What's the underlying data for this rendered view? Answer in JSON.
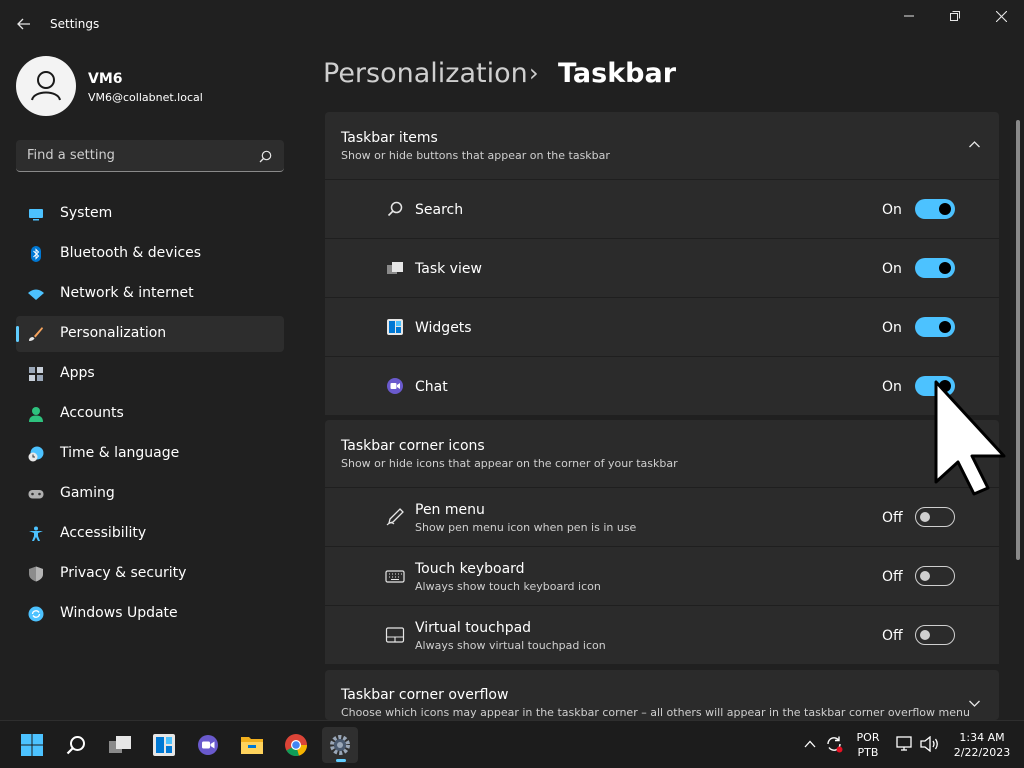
{
  "window": {
    "title": "Settings",
    "controls": {
      "minimize": "minimize-icon",
      "restore": "restore-icon",
      "close": "close-icon"
    }
  },
  "profile": {
    "name": "VM6",
    "email": "VM6@collabnet.local"
  },
  "search": {
    "placeholder": "Find a setting"
  },
  "nav": {
    "items": [
      {
        "label": "System",
        "icon": "system-icon",
        "color": "#4cc2ff"
      },
      {
        "label": "Bluetooth & devices",
        "icon": "bluetooth-icon",
        "color": "#0078d4"
      },
      {
        "label": "Network & internet",
        "icon": "wifi-icon",
        "color": "#4cc2ff"
      },
      {
        "label": "Personalization",
        "icon": "brush-icon",
        "color": "#f7a35c",
        "selected": true
      },
      {
        "label": "Apps",
        "icon": "apps-icon",
        "color": "#9aa7b8"
      },
      {
        "label": "Accounts",
        "icon": "accounts-icon",
        "color": "#2ec27e"
      },
      {
        "label": "Time & language",
        "icon": "clock-globe-icon",
        "color": "#4cc2ff"
      },
      {
        "label": "Gaming",
        "icon": "gamepad-icon",
        "color": "#b0b0b0"
      },
      {
        "label": "Accessibility",
        "icon": "accessibility-icon",
        "color": "#4cc2ff"
      },
      {
        "label": "Privacy & security",
        "icon": "shield-icon",
        "color": "#8c8c8c"
      },
      {
        "label": "Windows Update",
        "icon": "update-icon",
        "color": "#4cc2ff"
      }
    ]
  },
  "breadcrumb": {
    "parent": "Personalization",
    "separator": "›",
    "current": "Taskbar"
  },
  "sections": {
    "taskbar_items": {
      "title": "Taskbar items",
      "subtitle": "Show or hide buttons that appear on the taskbar",
      "rows": [
        {
          "label": "Search",
          "state": "On",
          "icon": "search-icon"
        },
        {
          "label": "Task view",
          "state": "On",
          "icon": "task-view-icon"
        },
        {
          "label": "Widgets",
          "state": "On",
          "icon": "widgets-icon"
        },
        {
          "label": "Chat",
          "state": "On",
          "icon": "chat-icon"
        }
      ]
    },
    "corner_icons": {
      "title": "Taskbar corner icons",
      "subtitle": "Show or hide icons that appear on the corner of your taskbar",
      "rows": [
        {
          "label": "Pen menu",
          "desc": "Show pen menu icon when pen is in use",
          "state": "Off",
          "icon": "pen-icon"
        },
        {
          "label": "Touch keyboard",
          "desc": "Always show touch keyboard icon",
          "state": "Off",
          "icon": "keyboard-icon"
        },
        {
          "label": "Virtual touchpad",
          "desc": "Always show virtual touchpad icon",
          "state": "Off",
          "icon": "touchpad-icon"
        }
      ]
    },
    "corner_overflow": {
      "title": "Taskbar corner overflow",
      "subtitle": "Choose which icons may appear in the taskbar corner – all others will appear in the taskbar corner overflow menu"
    }
  },
  "taskbar": {
    "apps": [
      "start-icon",
      "search-icon",
      "task-view-icon",
      "widgets-icon",
      "chat-icon",
      "file-explorer-icon",
      "chrome-icon",
      "settings-icon"
    ],
    "tray": {
      "lang_top": "POR",
      "lang_bottom": "PTB",
      "time": "1:34 AM",
      "date": "2/22/2023"
    }
  },
  "colors": {
    "accent": "#4cc2ff",
    "background": "#202020",
    "card": "#2b2b2b",
    "taskbar": "#1c1c1c"
  }
}
